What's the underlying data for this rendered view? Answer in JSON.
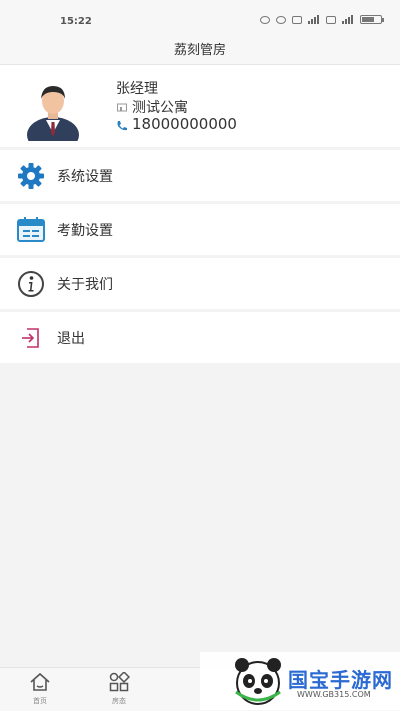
{
  "status_bar": {
    "time": "15:22"
  },
  "header": {
    "title": "荔刻管房"
  },
  "profile": {
    "name": "张经理",
    "apartment": "测试公寓",
    "phone": "18000000000"
  },
  "menu": {
    "items": [
      {
        "label": "系统设置",
        "icon": "gear-icon"
      },
      {
        "label": "考勤设置",
        "icon": "calendar-icon"
      },
      {
        "label": "关于我们",
        "icon": "info-icon"
      },
      {
        "label": "退出",
        "icon": "logout-icon"
      }
    ]
  },
  "bottom_nav": {
    "items": [
      {
        "label": "首页",
        "icon": "home-icon"
      },
      {
        "label": "房态",
        "icon": "apps-icon"
      }
    ]
  },
  "watermark": {
    "text": "国宝手游网",
    "sub": "WWW.GB315.COM"
  },
  "colors": {
    "accent": "#2a7fc0",
    "background": "#f3f3f3",
    "logout": "#c0306a"
  }
}
